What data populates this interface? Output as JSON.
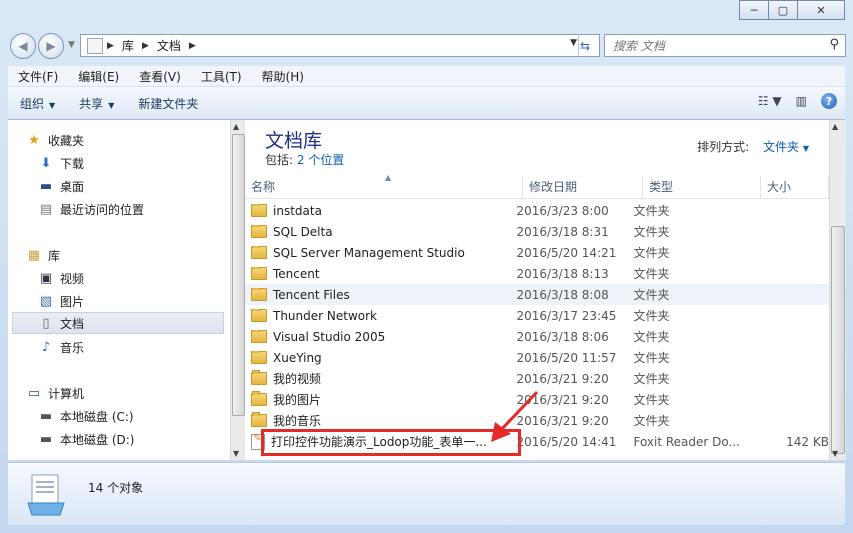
{
  "window": {
    "caption_buttons": [
      "─",
      "▢",
      "✕"
    ]
  },
  "address": {
    "crumbs": [
      "库",
      "文档"
    ]
  },
  "search": {
    "placeholder": "搜索 文档"
  },
  "menu": [
    "文件(F)",
    "编辑(E)",
    "查看(V)",
    "工具(T)",
    "帮助(H)"
  ],
  "toolbar": {
    "organize": "组织",
    "share": "共享",
    "new_folder": "新建文件夹"
  },
  "nav": {
    "favorites": "收藏夹",
    "downloads": "下载",
    "desktop": "桌面",
    "recent": "最近访问的位置",
    "libraries": "库",
    "videos": "视频",
    "pictures": "图片",
    "documents": "文档",
    "music": "音乐",
    "computer": "计算机",
    "drive_c": "本地磁盘 (C:)",
    "drive_d": "本地磁盘 (D:)"
  },
  "library": {
    "title": "文档库",
    "includes_label": "包括:",
    "includes_link": "2 个位置",
    "arrange_label": "排列方式:",
    "arrange_value": "文件夹"
  },
  "columns": {
    "name": "名称",
    "date": "修改日期",
    "type": "类型",
    "size": "大小"
  },
  "files": [
    {
      "name": "instdata",
      "date": "2016/3/23 8:00",
      "type": "文件夹",
      "size": "",
      "icon": "folder-icon"
    },
    {
      "name": "SQL Delta",
      "date": "2016/3/18 8:31",
      "type": "文件夹",
      "size": "",
      "icon": "folder-icon"
    },
    {
      "name": "SQL Server Management Studio",
      "date": "2016/5/20 14:21",
      "type": "文件夹",
      "size": "",
      "icon": "folder-icon"
    },
    {
      "name": "Tencent",
      "date": "2016/3/18 8:13",
      "type": "文件夹",
      "size": "",
      "icon": "folder-icon"
    },
    {
      "name": "Tencent Files",
      "date": "2016/3/18 8:08",
      "type": "文件夹",
      "size": "",
      "icon": "folder-icon"
    },
    {
      "name": "Thunder Network",
      "date": "2016/3/17 23:45",
      "type": "文件夹",
      "size": "",
      "icon": "folder-icon"
    },
    {
      "name": "Visual Studio 2005",
      "date": "2016/3/18 8:06",
      "type": "文件夹",
      "size": "",
      "icon": "folder-icon"
    },
    {
      "name": "XueYing",
      "date": "2016/5/20 11:57",
      "type": "文件夹",
      "size": "",
      "icon": "folder-icon"
    },
    {
      "name": "我的视频",
      "date": "2016/3/21 9:20",
      "type": "文件夹",
      "size": "",
      "icon": "folder-icon"
    },
    {
      "name": "我的图片",
      "date": "2016/3/21 9:20",
      "type": "文件夹",
      "size": "",
      "icon": "folder-icon"
    },
    {
      "name": "我的音乐",
      "date": "2016/3/21 9:20",
      "type": "文件夹",
      "size": "",
      "icon": "folder-icon"
    },
    {
      "name": "打印控件功能演示_Lodop功能_表单一...",
      "date": "2016/5/20 14:41",
      "type": "Foxit Reader Do...",
      "size": "142 KB",
      "icon": "document-icon"
    }
  ],
  "status": {
    "count": "14 个对象"
  },
  "colors": {
    "annotation": "#e52a2a",
    "link": "#0d5bb5",
    "title": "#1e3287"
  }
}
